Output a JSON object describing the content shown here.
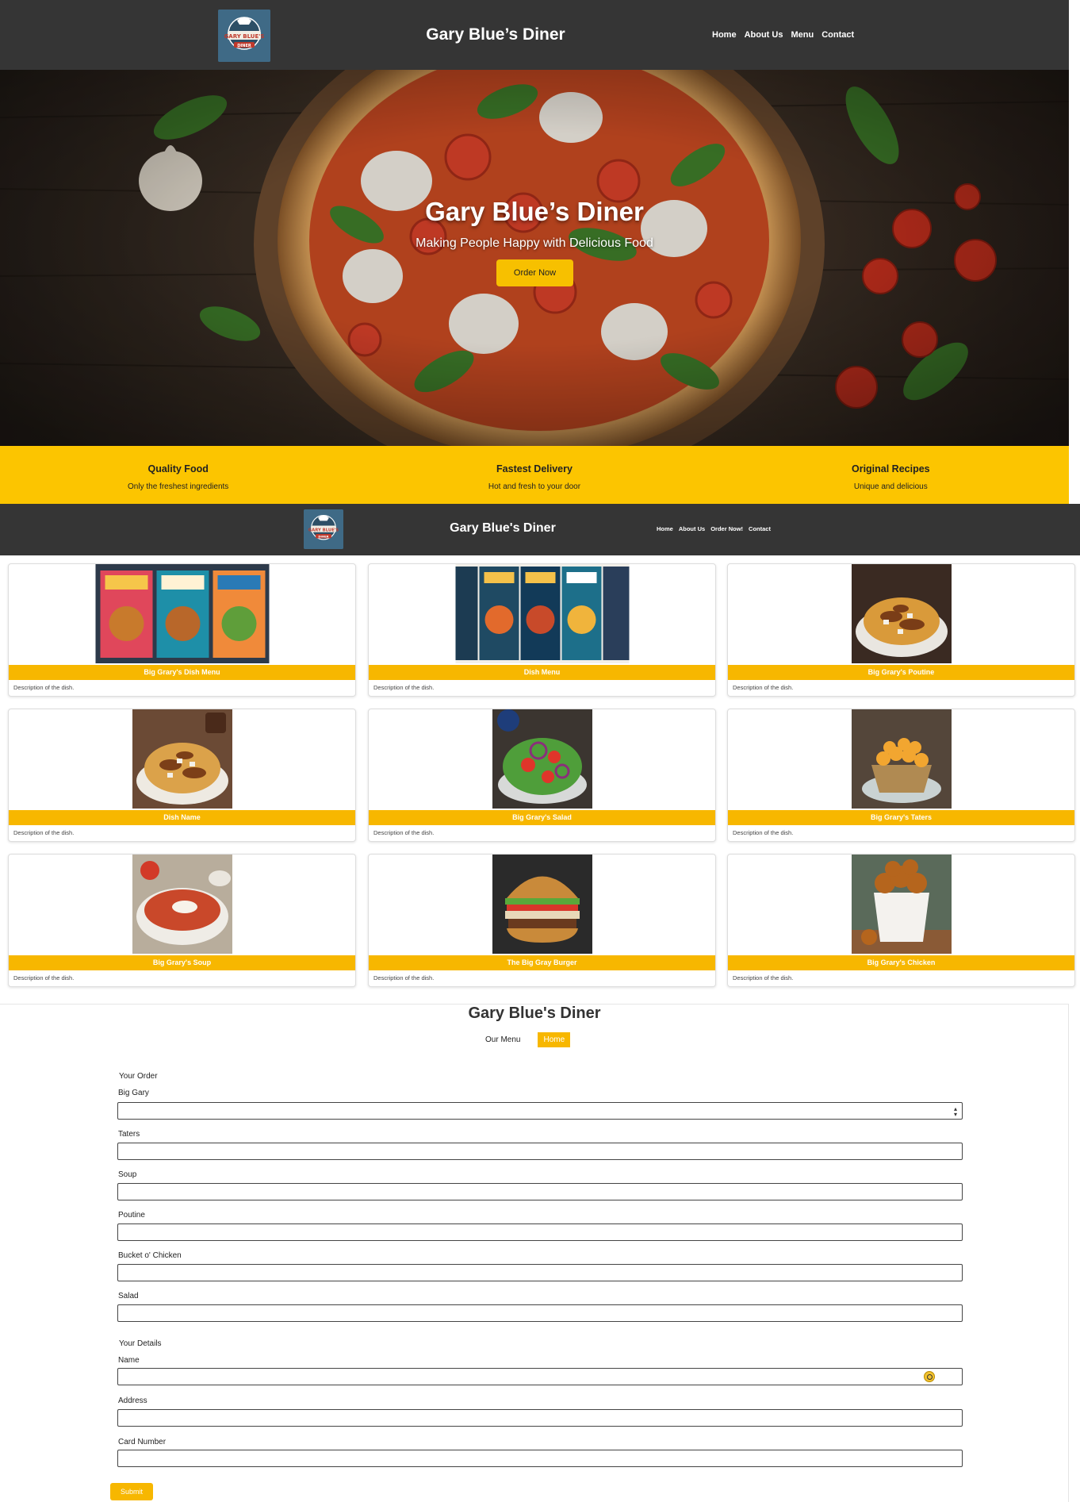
{
  "header": {
    "site_title": "Gary Blue’s Diner",
    "logo_text": "GARY BLUE'S",
    "logo_sub": "DINER",
    "nav": [
      "Home",
      "About Us",
      "Menu",
      "Contact"
    ]
  },
  "hero": {
    "title": "Gary Blue’s Diner",
    "subtitle": "Making People Happy with Delicious Food",
    "cta_label": "Order Now"
  },
  "features": [
    {
      "title": "Quality Food",
      "text": "Only the freshest ingredients"
    },
    {
      "title": "Fastest Delivery",
      "text": "Hot and fresh to your door"
    },
    {
      "title": "Original Recipes",
      "text": "Unique and delicious"
    }
  ],
  "header2": {
    "site_title": "Gary Blue's Diner",
    "nav": [
      "Home",
      "About Us",
      "Order Now!",
      "Contact"
    ]
  },
  "menu": {
    "cards": [
      {
        "title": "Big Grary's Dish Menu",
        "description": "Description of the dish.",
        "image": "menu-posters"
      },
      {
        "title": "Dish Menu",
        "description": "Description of the dish.",
        "image": "menu-posters"
      },
      {
        "title": "Big Grary's Poutine",
        "description": "Description of the dish.",
        "image": "poutine"
      },
      {
        "title": "Dish Name",
        "description": "Description of the dish.",
        "image": "poutine"
      },
      {
        "title": "Big Grary's Salad",
        "description": "Description of the dish.",
        "image": "salad"
      },
      {
        "title": "Big Grary's Taters",
        "description": "Description of the dish.",
        "image": "taters"
      },
      {
        "title": "Big Grary's Soup",
        "description": "Description of the dish.",
        "image": "soup"
      },
      {
        "title": "The Big Gray Burger",
        "description": "Description of the dish.",
        "image": "burger"
      },
      {
        "title": "Big Grary's Chicken",
        "description": "Description of the dish.",
        "image": "chicken-bucket"
      }
    ]
  },
  "order_form": {
    "title": "Gary Blue's Diner",
    "tabs": {
      "menu": "Our Menu",
      "home": "Home"
    },
    "order_section": "Your Order",
    "order_fields": [
      "Big Gary",
      "Taters",
      "Soup",
      "Poutine",
      "Bucket o' Chicken",
      "Salad"
    ],
    "details_section": "Your Details",
    "detail_fields": [
      "Name",
      "Address",
      "Card Number"
    ],
    "submit_label": "Submit"
  },
  "colors": {
    "header_bg": "#353535",
    "accent_yellow": "#fcc500",
    "button_yellow": "#f7b700",
    "logo_blue": "#3f6a86"
  }
}
